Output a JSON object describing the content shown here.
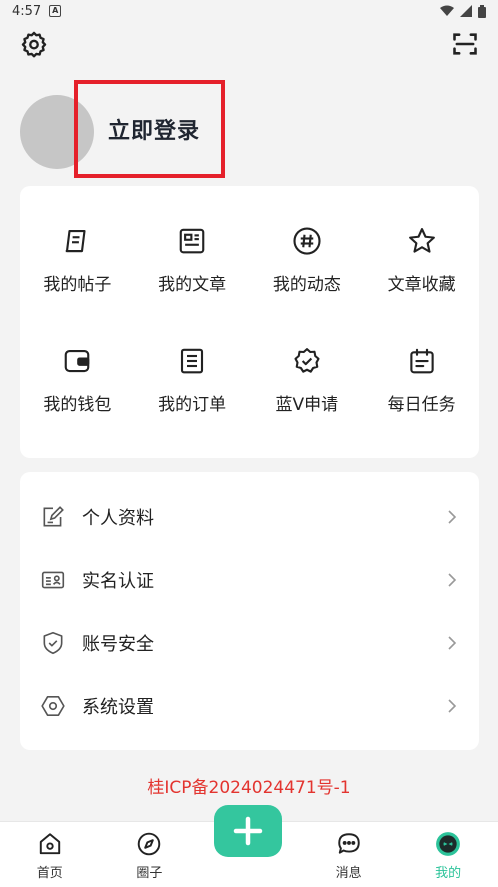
{
  "status_bar": {
    "time": "4:57",
    "badge": "A"
  },
  "header": {
    "settings_icon": "gear-icon",
    "scan_icon": "scan-icon"
  },
  "profile": {
    "login_text": "立即登录"
  },
  "grid": [
    {
      "label": "我的帖子",
      "icon": "post-icon"
    },
    {
      "label": "我的文章",
      "icon": "article-icon"
    },
    {
      "label": "我的动态",
      "icon": "hashtag-icon"
    },
    {
      "label": "文章收藏",
      "icon": "star-icon"
    },
    {
      "label": "我的钱包",
      "icon": "wallet-icon"
    },
    {
      "label": "我的订单",
      "icon": "order-icon"
    },
    {
      "label": "蓝V申请",
      "icon": "badge-check-icon"
    },
    {
      "label": "每日任务",
      "icon": "calendar-icon"
    }
  ],
  "list": [
    {
      "label": "个人资料",
      "icon": "edit-icon"
    },
    {
      "label": "实名认证",
      "icon": "id-card-icon"
    },
    {
      "label": "账号安全",
      "icon": "shield-icon"
    },
    {
      "label": "系统设置",
      "icon": "hexagon-icon"
    }
  ],
  "icp": "桂ICP备2024024471号-1",
  "bottom_nav": [
    {
      "label": "首页",
      "icon": "home-icon"
    },
    {
      "label": "圈子",
      "icon": "compass-icon"
    },
    {
      "label": "消息",
      "icon": "message-icon"
    },
    {
      "label": "我的",
      "icon": "profile-face-icon"
    }
  ],
  "colors": {
    "accent": "#34c69e",
    "highlight_box": "#e5202a",
    "icp": "#e3342f"
  }
}
